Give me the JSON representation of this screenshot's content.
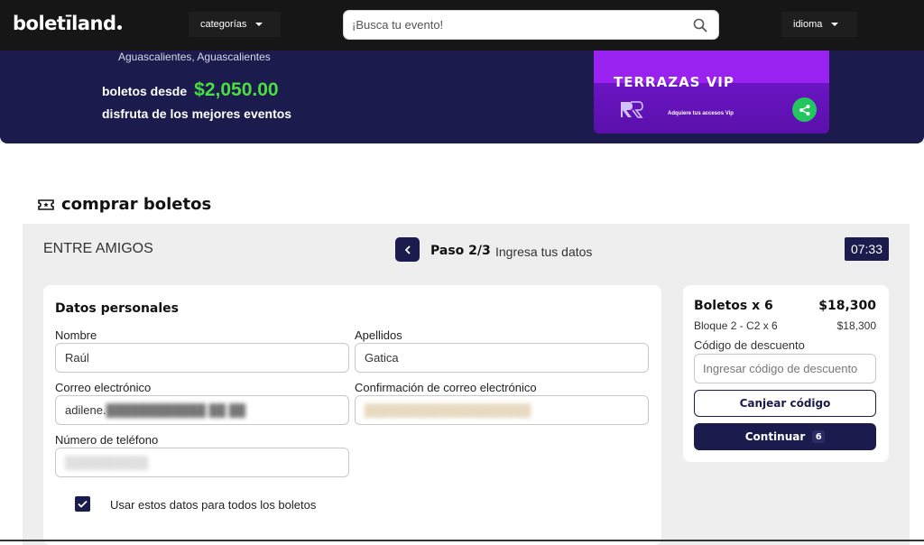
{
  "nav": {
    "logo": "boletīland",
    "categories_label": "categorías",
    "search_placeholder": "¡Busca tu evento!",
    "language_label": "idioma"
  },
  "hero": {
    "location": "Aguascalientes, Aguascalientes",
    "tickets_from_label": "boletos desde",
    "price": "$2,050.00",
    "tagline": "disfruta de los mejores eventos",
    "banner": {
      "title": "TERRAZAS VIP",
      "subtitle": "Adquiere tus accesos Vip"
    }
  },
  "section": {
    "title": "comprar boletos"
  },
  "purchase": {
    "event_name": "ENTRE AMIGOS",
    "step": "Paso 2/3",
    "step_desc": "Ingresa tus datos",
    "timer": "07:33"
  },
  "form": {
    "title": "Datos personales",
    "first_name_label": "Nombre",
    "first_name_value": "Raúl",
    "last_name_label": "Apellidos",
    "last_name_value": "Gatica",
    "email_label": "Correo electrónico",
    "email_value": "adilene.",
    "email_confirm_label": "Confirmación de correo electrónico",
    "phone_label": "Número de teléfono",
    "use_for_all_label": "Usar estos datos para todos los boletos"
  },
  "summary": {
    "title": "Boletos x 6",
    "total": "$18,300",
    "line_item": "Bloque 2 - C2 x 6",
    "line_value": "$18,300",
    "discount_label": "Código de descuento",
    "discount_placeholder": "Ingresar código de descuento",
    "redeem_label": "Canjear código",
    "continue_label": "Continuar",
    "continue_badge": "6"
  },
  "colors": {
    "navy": "#1c1b4d",
    "price_green": "#4ade40",
    "banner_purple": "#8a1be0",
    "share_green": "#22c55e"
  },
  "icons": [
    "search-icon",
    "chevron-down-icon",
    "share-icon",
    "ticket-icon",
    "chevron-left-icon",
    "check-icon"
  ]
}
